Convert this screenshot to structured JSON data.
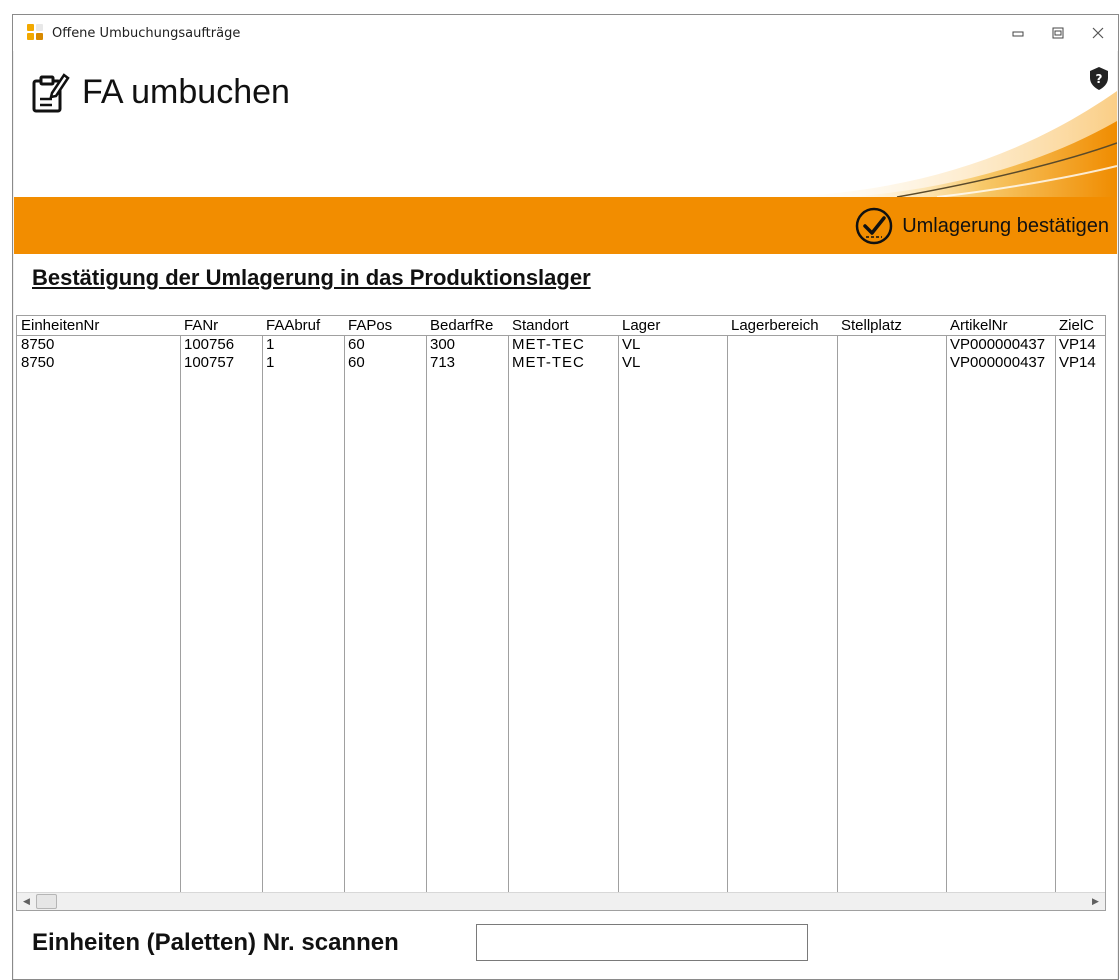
{
  "window": {
    "title": "Offene Umbuchungsaufträge",
    "controls": [
      "minimize-icon",
      "maximize-icon",
      "close-icon"
    ]
  },
  "header": {
    "title": "FA umbuchen",
    "icons": [
      "document-edit-icon",
      "help-shield-icon"
    ]
  },
  "toolbar": {
    "confirm_label": "Umlagerung bestätigen",
    "confirm_icon": "check-circle-icon",
    "accent": "#f28d00"
  },
  "section": {
    "title": "Bestätigung der Umlagerung in das Produktionslager"
  },
  "table": {
    "columns": [
      "EinheitenNr",
      "FANr",
      "FAAbruf",
      "FAPos",
      "BedarfRe",
      "Standort",
      "Lager",
      "Lagerbereich",
      "Stellplatz",
      "ArtikelNr",
      "ZielC"
    ],
    "rows": [
      [
        "8750",
        "100756",
        "1",
        "60",
        "300",
        "MET-TEC",
        "VL",
        "",
        "",
        "VP000000437",
        "VP14"
      ],
      [
        "8750",
        "100757",
        "1",
        "60",
        "713",
        "MET-TEC",
        "VL",
        "",
        "",
        "VP000000437",
        "VP14"
      ]
    ]
  },
  "scan": {
    "label": "Einheiten (Paletten) Nr. scannen",
    "value": "",
    "placeholder": ""
  }
}
